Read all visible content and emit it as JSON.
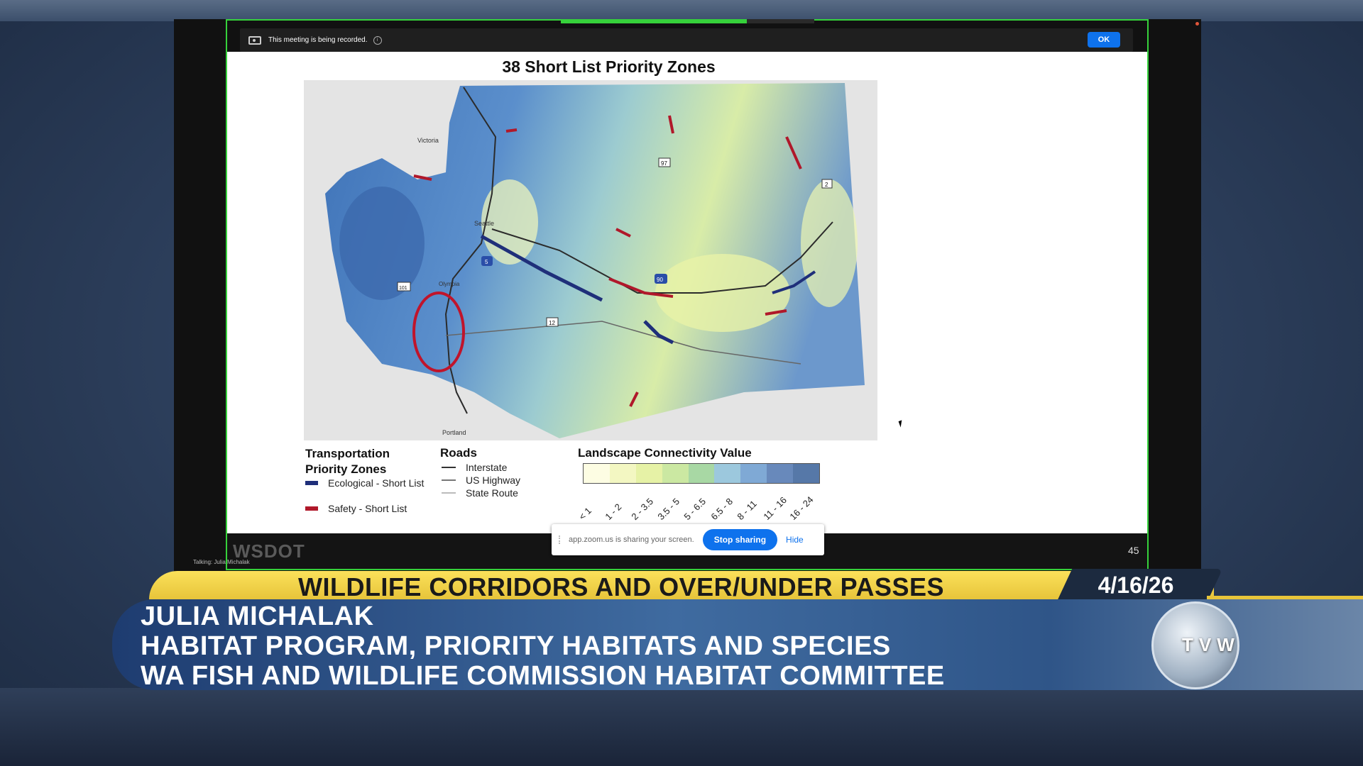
{
  "zoom": {
    "recording_notice": "This meeting is being recorded.",
    "ok_label": "OK",
    "share_notice": "app.zoom.us is sharing your screen.",
    "stop_sharing_label": "Stop sharing",
    "hide_label": "Hide",
    "slide_number": "45",
    "talking_label": "Talking: Julia Michalak",
    "logo_watermark": "WSDOT",
    "share_border_color": "#36d13b",
    "accent_color": "#0e72ed"
  },
  "slide": {
    "title": "38 Short List Priority Zones",
    "map_labels": {
      "seattle": "Seattle",
      "portland": "Portland",
      "victoria": "Victoria",
      "olympia": "Olympia",
      "i5": "5",
      "i90": "90",
      "us12": "12",
      "us97": "97",
      "us2": "2",
      "us101": "101"
    },
    "legend": {
      "tpz_title": "Transportation Priority Zones",
      "ecological": "Ecological - Short List",
      "safety": "Safety - Short List",
      "ecological_color": "#1f2f7a",
      "safety_color": "#b0182a",
      "roads_title": "Roads",
      "interstate": "Interstate",
      "us_highway": "US Highway",
      "state_route": "State Route",
      "lcv_title": "Landscape Connectivity Value",
      "lcv_ticks": [
        "< 1",
        "1 - 2",
        "2 - 3.5",
        "3.5 - 5",
        "5 - 6.5",
        "6.5 - 8",
        "8 - 11",
        "11 - 16",
        "16 - 24"
      ],
      "lcv_colors": [
        "#fdfde3",
        "#f3f7c2",
        "#e6f2a6",
        "#cbe8a2",
        "#a8d8a4",
        "#9cc8dd",
        "#7fa9d5",
        "#6889bb",
        "#5678a8"
      ]
    }
  },
  "broadcast": {
    "topic": "WILDLIFE CORRIDORS AND OVER/UNDER PASSES",
    "date": "4/16/26",
    "speaker_name": "JULIA MICHALAK",
    "speaker_title": "HABITAT PROGRAM, PRIORITY HABITATS AND SPECIES",
    "speaker_org": "WA FISH AND WILDLIFE COMMISSION HABITAT COMMITTEE",
    "logo_text": "TVW"
  }
}
